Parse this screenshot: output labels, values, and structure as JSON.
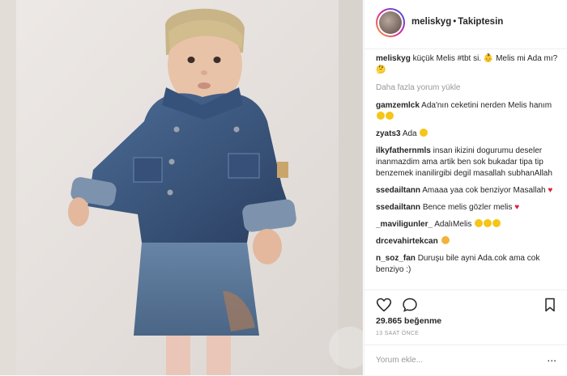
{
  "post": {
    "username": "meliskyg",
    "follow_status": "Takiptesin",
    "separator": "•",
    "caption_user": "meliskyg",
    "caption_text": "küçük Melis #tbt si. 👶 Melis mi Ada mı?🤔",
    "load_more": "Daha fazla yorum yükle",
    "likes": "29.865 beğenme",
    "time": "13 SAAT ÖNCE",
    "add_comment_placeholder": "Yorum ekle...",
    "more_options": "..."
  },
  "comments": [
    {
      "user": "gamzemlck",
      "text": "Ada'nın ceketini nerden Melis hanım"
    },
    {
      "user": "zyats3",
      "text": "Ada"
    },
    {
      "user": "ilkyfathernmls",
      "text": "insan ikizini dogurumu deseler inanmazdim ama artik ben sok bukadar tipa tip benzemek inanilirgibi degil masallah subhanAllah"
    },
    {
      "user": "ssedailtann",
      "text": "Amaaa yaa cok benziyor Masallah"
    },
    {
      "user": "ssedailtann",
      "text": "Bence melis gözler melis"
    },
    {
      "user": "_maviligunler_",
      "text": "AdalıMelis"
    },
    {
      "user": "drcevahirtekcan",
      "text": ""
    },
    {
      "user": "n_soz_fan",
      "text": "Duruşu bile ayni Ada.cok ama cok benziyo :)"
    }
  ],
  "icons": {
    "like": "heart-outline-icon",
    "comment": "comment-bubble-icon",
    "save": "bookmark-icon"
  },
  "colors": {
    "text": "#262626",
    "muted": "#999999",
    "heart": "#d8233c",
    "denim": "#3f5f8c"
  }
}
